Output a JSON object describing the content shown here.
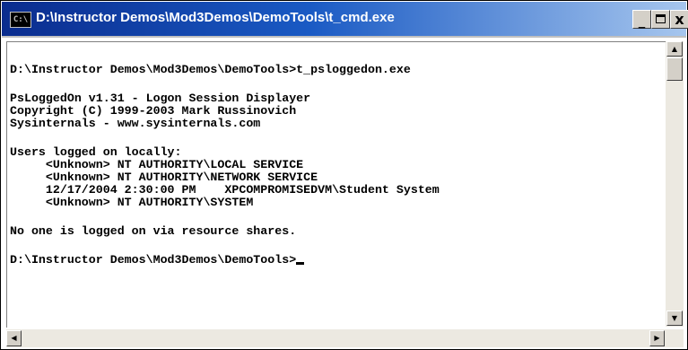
{
  "window": {
    "title": "D:\\Instructor Demos\\Mod3Demos\\DemoTools\\t_cmd.exe",
    "icon_text": "C:\\",
    "controls": {
      "minimize": "_",
      "close": "x"
    }
  },
  "console": {
    "lines": [
      "D:\\Instructor Demos\\Mod3Demos\\DemoTools>t_psloggedon.exe",
      "",
      "PsLoggedOn v1.31 - Logon Session Displayer",
      "Copyright (C) 1999-2003 Mark Russinovich",
      "Sysinternals - www.sysinternals.com",
      "",
      "Users logged on locally:",
      "     <Unknown> NT AUTHORITY\\LOCAL SERVICE",
      "     <Unknown> NT AUTHORITY\\NETWORK SERVICE",
      "     12/17/2004 2:30:00 PM    XPCOMPROMISEDVM\\Student System",
      "     <Unknown> NT AUTHORITY\\SYSTEM",
      "",
      "No one is logged on via resource shares.",
      "",
      "D:\\Instructor Demos\\Mod3Demos\\DemoTools>"
    ]
  },
  "scrollbars": {
    "up_arrow": "▲",
    "down_arrow": "▼",
    "left_arrow": "◀",
    "right_arrow": "▶"
  },
  "colors": {
    "title_start": "#0a2c8e",
    "title_end": "#a6c6ee",
    "console_bg": "#ffffff",
    "console_text": "#000000"
  }
}
